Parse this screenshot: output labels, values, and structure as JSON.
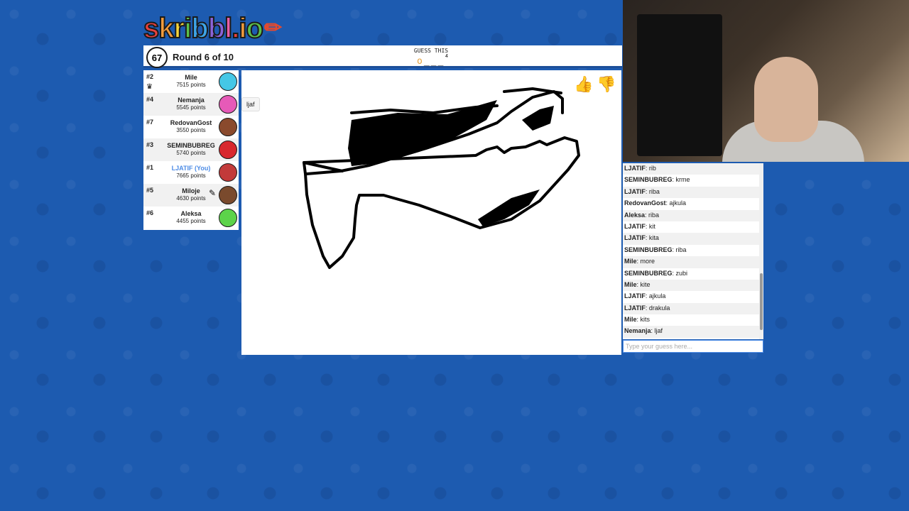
{
  "logo": {
    "text": "skribbl.io",
    "colors": [
      "#e8423d",
      "#f39c3d",
      "#f5d43c",
      "#5cbf4a",
      "#3ea4e6",
      "#8b63d7",
      "#e85ea5",
      "#e8423d",
      "#f39c3d",
      "#5cbf4a"
    ]
  },
  "timer": {
    "seconds": "67"
  },
  "round": {
    "label": "Round 6 of 10"
  },
  "word": {
    "label": "GUESS THIS",
    "revealed": "o",
    "blanks": "___",
    "length": "4"
  },
  "players": [
    {
      "rank": "#2",
      "name": "Mile",
      "points": "7515 points",
      "avatar_color": "#45c7e6",
      "has_crown": true,
      "is_you": false,
      "drawing": false
    },
    {
      "rank": "#4",
      "name": "Nemanja",
      "points": "5545 points",
      "avatar_color": "#e65ab8",
      "has_crown": false,
      "is_you": false,
      "drawing": false
    },
    {
      "rank": "#7",
      "name": "RedovanGost",
      "points": "3550 points",
      "avatar_color": "#8a4a2d",
      "has_crown": false,
      "is_you": false,
      "drawing": false
    },
    {
      "rank": "#3",
      "name": "SEMINBUBREG",
      "points": "5740 points",
      "avatar_color": "#d8282e",
      "has_crown": false,
      "is_you": false,
      "drawing": false
    },
    {
      "rank": "#1",
      "name": "LJATIF (You)",
      "points": "7665 points",
      "avatar_color": "#c23a3a",
      "has_crown": false,
      "is_you": true,
      "drawing": false
    },
    {
      "rank": "#5",
      "name": "Miloje",
      "points": "4630 points",
      "avatar_color": "#7a4a2d",
      "has_crown": false,
      "is_you": false,
      "drawing": true
    },
    {
      "rank": "#6",
      "name": "Aleksa",
      "points": "4455 points",
      "avatar_color": "#5cd34a",
      "has_crown": false,
      "is_you": false,
      "drawing": false
    }
  ],
  "speech_bubble": {
    "text": "ljaf"
  },
  "chat": [
    {
      "name": "LJATIF",
      "text": "rib"
    },
    {
      "name": "SEMINBUBREG",
      "text": "krme"
    },
    {
      "name": "LJATIF",
      "text": "riba"
    },
    {
      "name": "RedovanGost",
      "text": "ajkula"
    },
    {
      "name": "Aleksa",
      "text": "riba"
    },
    {
      "name": "LJATIF",
      "text": "kit"
    },
    {
      "name": "LJATIF",
      "text": "kita"
    },
    {
      "name": "SEMINBUBREG",
      "text": "riba"
    },
    {
      "name": "Mile",
      "text": "more"
    },
    {
      "name": "SEMINBUBREG",
      "text": "zubi"
    },
    {
      "name": "Mile",
      "text": "kite"
    },
    {
      "name": "LJATIF",
      "text": "ajkula"
    },
    {
      "name": "LJATIF",
      "text": "drakula"
    },
    {
      "name": "Mile",
      "text": "kits"
    },
    {
      "name": "Nemanja",
      "text": "ljaf"
    }
  ],
  "guess_input": {
    "placeholder": "Type your guess here...",
    "value": ""
  },
  "icons": {
    "thumbs_up": "thumbs-up-icon",
    "thumbs_down": "thumbs-down-icon",
    "crown": "crown-icon",
    "pencil": "pencil-icon"
  }
}
